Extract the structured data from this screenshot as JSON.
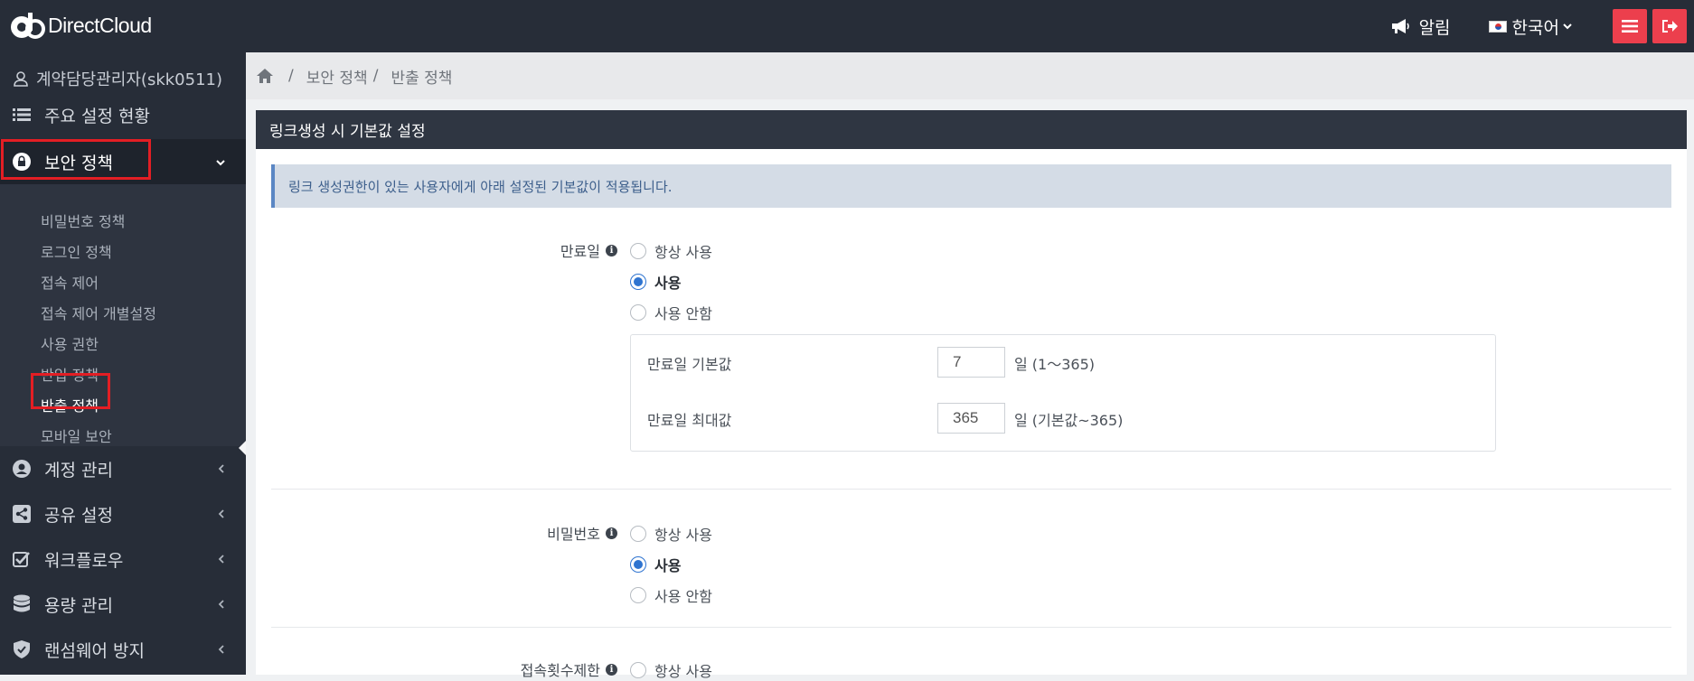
{
  "app": {
    "brand": "DirectCloud"
  },
  "topbar": {
    "notify_label": "알림",
    "lang_label": "한국어"
  },
  "sidebar": {
    "user": "계약담당관리자(skk0511)",
    "items": [
      {
        "label": "주요 설정 현황",
        "icon": "list-icon"
      },
      {
        "label": "보안 정책",
        "icon": "lock-icon"
      },
      {
        "label": "계정 관리",
        "icon": "user-circle-icon"
      },
      {
        "label": "공유 설정",
        "icon": "share-icon"
      },
      {
        "label": "워크플로우",
        "icon": "checkbox-icon"
      },
      {
        "label": "용량 관리",
        "icon": "database-icon"
      },
      {
        "label": "랜섬웨어 방지",
        "icon": "shield-icon"
      }
    ],
    "submenu": [
      {
        "label": "비밀번호 정책"
      },
      {
        "label": "로그인 정책"
      },
      {
        "label": "접속 제어"
      },
      {
        "label": "접속 제어 개별설정"
      },
      {
        "label": "사용 권한"
      },
      {
        "label": "반입 정책"
      },
      {
        "label": "반출 정책"
      },
      {
        "label": "모바일 보안"
      }
    ]
  },
  "breadcrumb": {
    "level1": "보안 정책",
    "level2": "반출 정책"
  },
  "panel": {
    "title": "링크생성 시 기본값 설정",
    "info": "링크 생성권한이 있는 사용자에게 아래 설정된 기본값이 적용됩니다."
  },
  "expiry": {
    "label": "만료일",
    "options": [
      "항상 사용",
      "사용",
      "사용 안함"
    ],
    "selected": 1,
    "default_label": "만료일 기본값",
    "default_value": "7",
    "default_unit": "일 (1～365)",
    "max_label": "만료일 최대값",
    "max_value": "365",
    "max_unit": "일 (기본값~365)"
  },
  "password": {
    "label": "비밀번호",
    "options": [
      "항상 사용",
      "사용",
      "사용 안함"
    ],
    "selected": 1
  },
  "access_limit": {
    "label": "접속횟수제한",
    "options": [
      "항상 사용"
    ]
  }
}
